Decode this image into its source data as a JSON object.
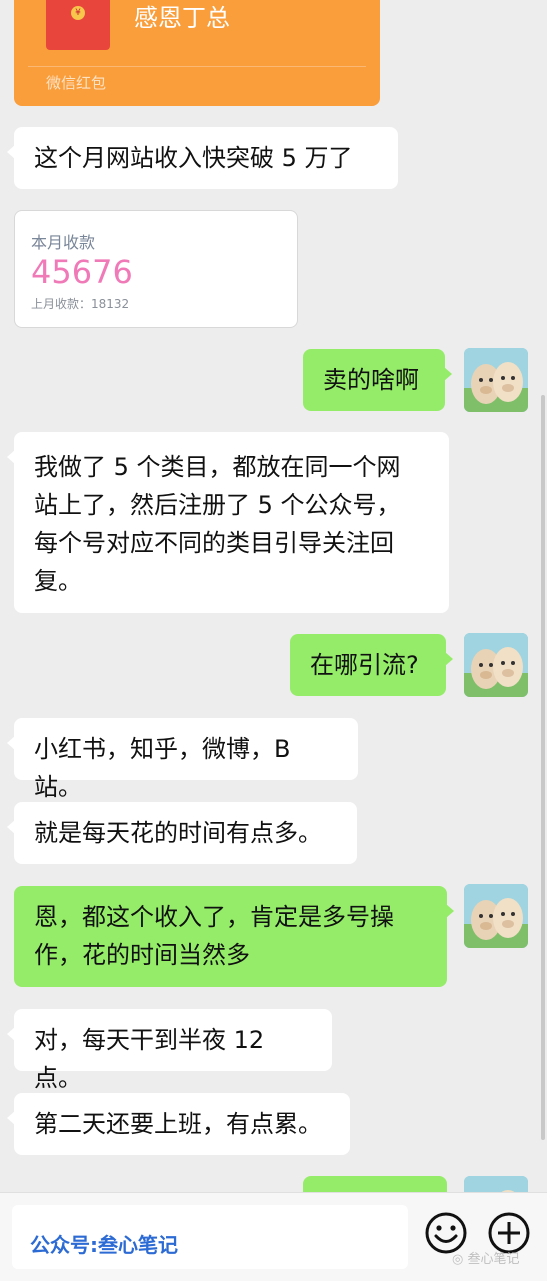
{
  "red_packet": {
    "title": "感恩丁总",
    "label": "微信红包",
    "coin_symbol": "¥"
  },
  "messages": [
    {
      "side": "left",
      "text": "这个月网站收入快突破 5 万了"
    },
    {
      "side": "right",
      "text": "卖的啥啊"
    },
    {
      "side": "left",
      "lines": [
        "我做了 5 个类目，都放在同一个网",
        "站上了，然后注册了 5 个公众号，",
        "每个号对应不同的类目引导关注回",
        "复。"
      ]
    },
    {
      "side": "right",
      "text": "在哪引流?"
    },
    {
      "side": "left",
      "text": "小红书，知乎，微博，B 站。"
    },
    {
      "side": "left",
      "text": "就是每天花的时间有点多。"
    },
    {
      "side": "right",
      "lines": [
        "恩，都这个收入了，肯定是多号操",
        "作，花的时间当然多"
      ]
    },
    {
      "side": "left",
      "text": "对，每天干到半夜 12 点。"
    },
    {
      "side": "left",
      "text": "第二天还要上班，有点累。"
    }
  ],
  "income_card": {
    "label": "本月收款",
    "value": "45676",
    "sub": "上月收款：18132"
  },
  "input_bar": {
    "watermark": "公众号:叁心笔记",
    "corner_mark": "叁心笔记"
  },
  "colors": {
    "chat_bg": "#ededed",
    "bubble_self": "#95ec69",
    "bubble_other": "#ffffff",
    "red_packet": "#fa9d3b",
    "income_value": "#f07ab8"
  },
  "icons": [
    "emoji-icon",
    "plus-icon",
    "wechat-logo-icon",
    "red-packet-icon",
    "alpaca-avatar"
  ]
}
